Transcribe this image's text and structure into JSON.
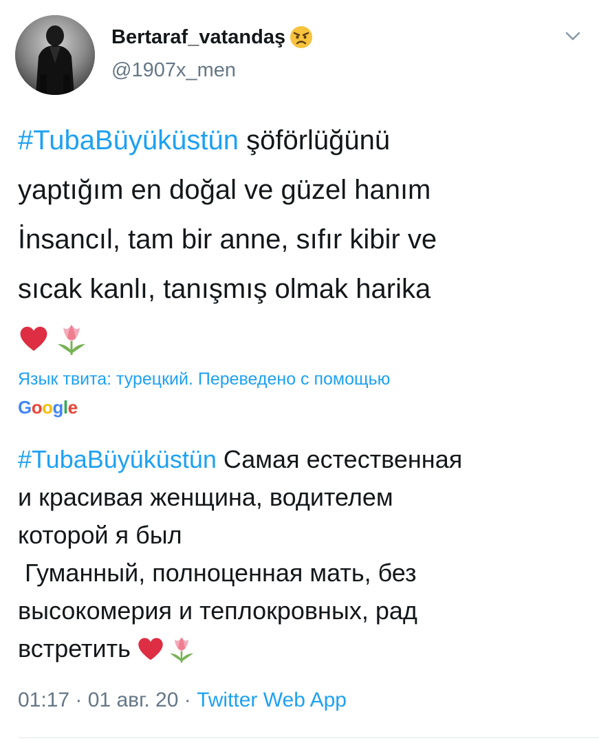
{
  "tweet": {
    "display_name": "Bertaraf_vatandaş",
    "name_emoji": "angry-face-icon",
    "handle": "@1907x_men",
    "menu_icon": "chevron-down-icon",
    "original": {
      "hashtag": "#TubaBüyüküstün",
      "line1_rest": " şöförlüğünü",
      "line2": "yaptığım en doğal ve güzel hanım",
      "line3": "İnsancıl, tam bir anne, sıfır kibir ve",
      "line4": "sıcak kanlı, tanışmış olmak harika",
      "emojis": [
        "red-heart-icon",
        "tulip-icon"
      ]
    },
    "translation_note": "Язык твита: турецкий. Переведено с помощью",
    "translator_brand": "Google",
    "translated": {
      "hashtag": "#TubaBüyüküstün",
      "line1_rest": " Самая естественная",
      "line2": "и красивая женщина, водителем",
      "line3": "которой я был",
      "line4": " Гуманный, полноценная мать, без",
      "line5": "высокомерия и теплокровных, рад",
      "line6": "встретить"
    },
    "meta": {
      "time": "01:17",
      "separator": " · ",
      "date": "01 авг. 20",
      "source": "Twitter Web App"
    }
  },
  "colors": {
    "link": "#1da1f2",
    "text": "#14171a",
    "secondary": "#657786",
    "divider": "#e1e8ed"
  }
}
